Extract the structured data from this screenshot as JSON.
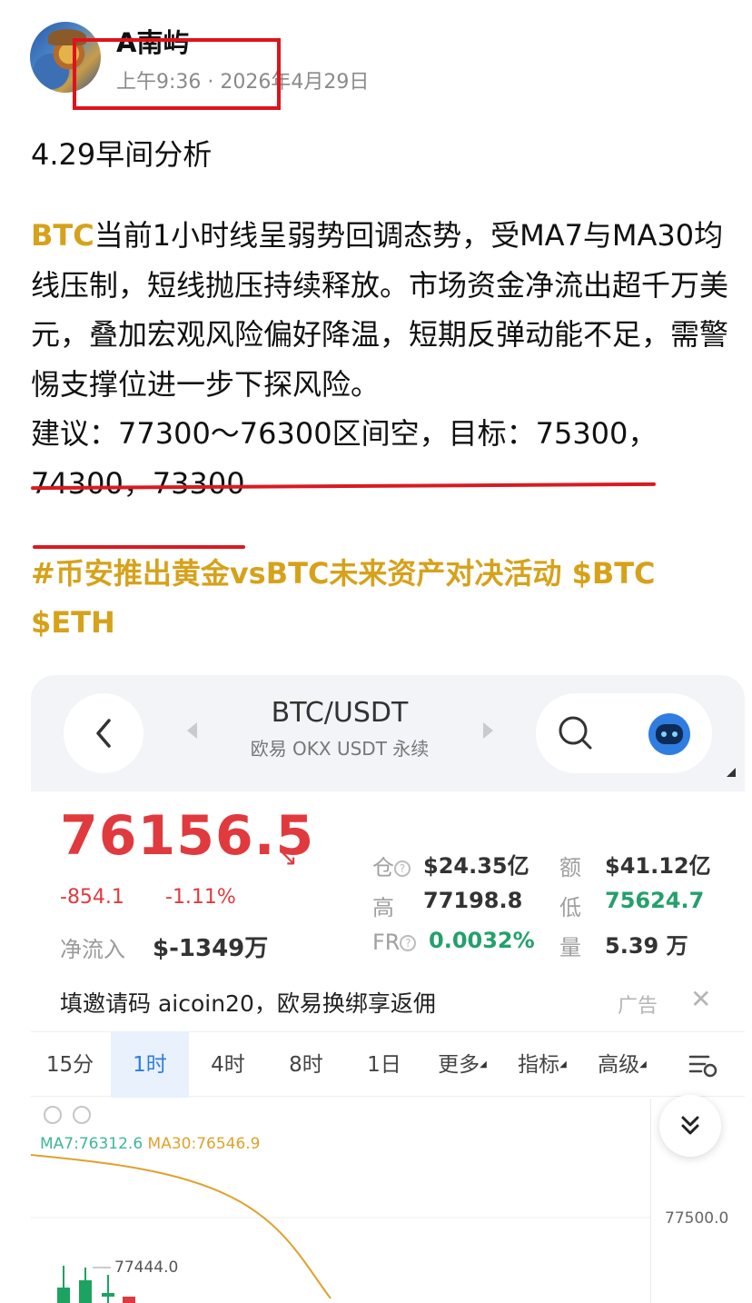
{
  "post": {
    "author": "A南屿",
    "timestamp": "上午9:36 · 2026年4月29日",
    "title": "4.29早间分析",
    "body": {
      "highlight": "BTC",
      "text": "当前1小时线呈弱势回调态势，受MA7与MA30均线压制，短线抛压持续释放。市场资金净流出超千万美元，叠加宏观风险偏好降温，短期反弹动能不足，需警惕支撑位进一步下探风险。",
      "suggestion": "建议：77300～76300区间空，目标：75300，74300，73300"
    },
    "tags": "#币安推出黄金vsBTC未来资产对决活动 $BTC $ETH"
  },
  "app": {
    "pair": "BTC/USDT",
    "exchange": "欧易 OKX USDT 永续",
    "price": "76156.5",
    "change": "-854.1",
    "change_pct": "-1.11%",
    "net_inflow_label": "净流入",
    "net_inflow_value": "$-1349万",
    "stats": {
      "oi_label": "仓",
      "oi_value": "$24.35亿",
      "vol_label": "额",
      "vol_value": "$41.12亿",
      "high_label": "高",
      "high_value": "77198.8",
      "low_label": "低",
      "low_value": "75624.7",
      "fr_label": "FR",
      "fr_value": "0.0032%",
      "qty_label": "量",
      "qty_value": "5.39 万"
    },
    "ad": {
      "text": "填邀请码 aicoin20，欧易换绑享返佣",
      "tag": "广告",
      "close": "✕"
    },
    "tabs": [
      "15分",
      "1时",
      "4时",
      "8时",
      "1日",
      "更多",
      "指标",
      "高级"
    ],
    "active_tab": "1时",
    "chart": {
      "ma7": "MA7:76312.6",
      "ma30": "MA30:76546.9",
      "y_label": "77500.0",
      "high_marker": "77444.0"
    }
  },
  "colors": {
    "accent_gold": "#d6a21b",
    "down_red": "#e03a3e",
    "up_green": "#24a06b",
    "annotation_red": "#e0121b",
    "tab_active": "#2f7de1"
  }
}
